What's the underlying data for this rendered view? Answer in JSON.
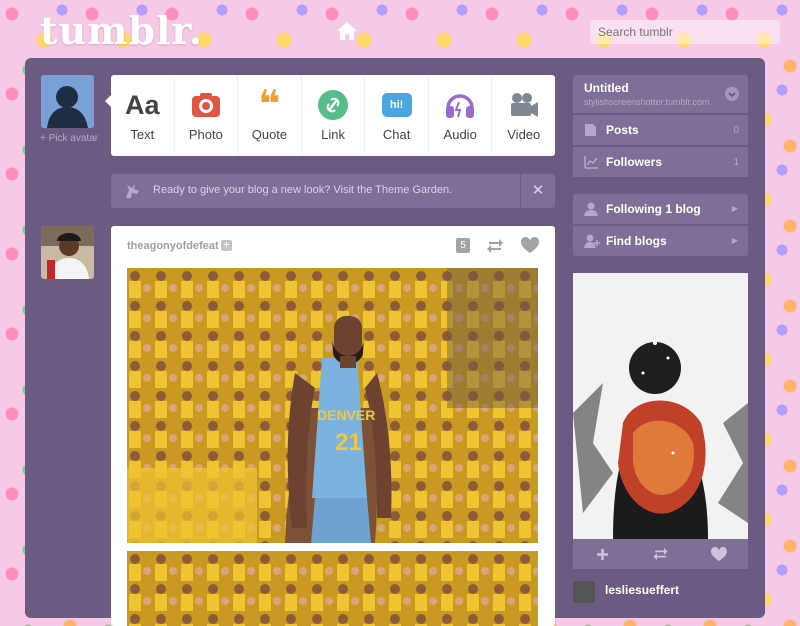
{
  "header": {
    "logo": "tumblr.",
    "search_placeholder": "Search tumblr",
    "brand_color": "#6b5b83"
  },
  "avatar": {
    "pick_label": "+ Pick avatar"
  },
  "post_types": [
    {
      "label": "Text",
      "glyph": "Aa",
      "icon": "text-icon",
      "color": "#444444"
    },
    {
      "label": "Photo",
      "icon": "camera-icon",
      "color": "#e05640"
    },
    {
      "label": "Quote",
      "glyph": "❝",
      "icon": "quote-icon",
      "color": "#f0a030"
    },
    {
      "label": "Link",
      "icon": "link-icon",
      "color": "#56bc8a"
    },
    {
      "label": "Chat",
      "glyph": "hi!",
      "icon": "chat-icon",
      "color": "#4aa5e0"
    },
    {
      "label": "Audio",
      "icon": "headphones-icon",
      "color": "#9b6bcc"
    },
    {
      "label": "Video",
      "icon": "video-camera-icon",
      "color": "#7f8793"
    }
  ],
  "notice": {
    "text": "Ready to give your blog a new look? Visit the Theme Garden.",
    "close": "✕"
  },
  "post": {
    "author": "theagonyofdefeat",
    "notes": "5",
    "jersey_team": "DENVER",
    "jersey_number": "21"
  },
  "sidebar": {
    "blog_title": "Untitled",
    "blog_url": "stylishscreenshotter.tumblr.com",
    "rows": [
      {
        "label": "Posts",
        "count": "0",
        "icon": "posts-icon"
      },
      {
        "label": "Followers",
        "count": "1",
        "icon": "followers-icon"
      }
    ],
    "following": "Following 1 blog",
    "find_blogs": "Find blogs",
    "radar_user": "lesliesueffert"
  }
}
